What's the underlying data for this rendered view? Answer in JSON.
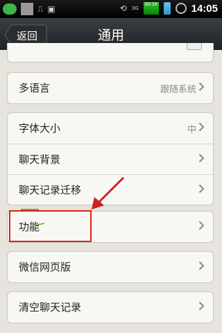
{
  "statusbar": {
    "icons": [
      "chat-icon",
      "document-icon",
      "usb-icon",
      "android-icon",
      "sync-icon",
      "network-3g-icon",
      "signal-icon",
      "battery-icon",
      "alarm-icon"
    ],
    "network_small": "3G",
    "signal_text": "3G 1X",
    "time": "14:05"
  },
  "header": {
    "back_label": "返回",
    "title": "通用"
  },
  "groups": [
    {
      "rows": [
        {
          "label": "多语言",
          "value": "跟随系统"
        }
      ]
    },
    {
      "rows": [
        {
          "label": "字体大小",
          "value": "中"
        },
        {
          "label": "聊天背景",
          "value": ""
        },
        {
          "label": "聊天记录迁移",
          "value": ""
        }
      ]
    },
    {
      "rows": [
        {
          "label": "功能",
          "value": ""
        }
      ]
    },
    {
      "rows": [
        {
          "label": "微信网页版",
          "value": ""
        }
      ]
    },
    {
      "rows": [
        {
          "label": "清空聊天记录",
          "value": ""
        }
      ]
    }
  ],
  "colors": {
    "annotation": "#d21f1f",
    "background": "#e6e4dc",
    "titlebar": "#2b2e31"
  }
}
